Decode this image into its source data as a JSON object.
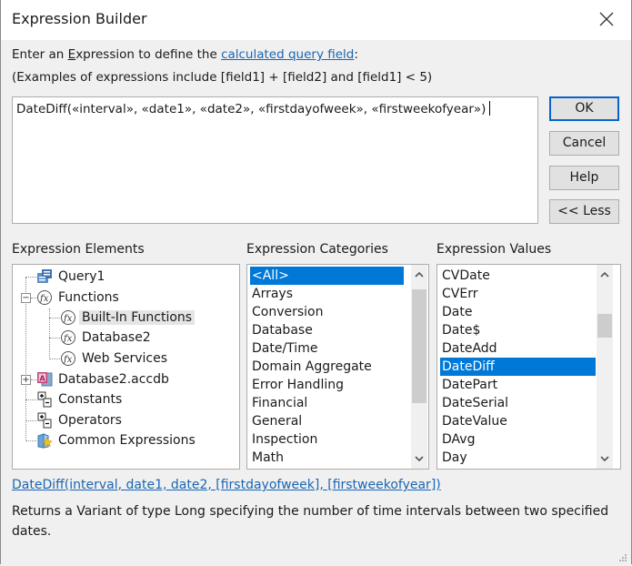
{
  "window": {
    "title": "Expression Builder",
    "close_icon": "close-icon"
  },
  "intro": {
    "line1_prefix": "Enter an ",
    "line1_accel": "E",
    "line1_mid": "xpression to define the ",
    "line1_link": "calculated query field",
    "line1_suffix": ":",
    "line2": "(Examples of expressions include [field1] + [field2] and [field1] < 5)"
  },
  "expression": {
    "value": "DateDiff(«interval», «date1», «date2», «firstdayofweek», «firstweekofyear»)"
  },
  "buttons": {
    "ok": "OK",
    "cancel": "Cancel",
    "help": "Help",
    "less": "<< Less"
  },
  "elements": {
    "header": "Expression Elements",
    "items": [
      {
        "label": "Query1",
        "icon": "query-icon",
        "level": 0,
        "expander": ""
      },
      {
        "label": "Functions",
        "icon": "function-icon",
        "level": 0,
        "expander": "collapse"
      },
      {
        "label": "Built-In Functions",
        "icon": "function-icon",
        "level": 1,
        "expander": "",
        "selected": true
      },
      {
        "label": "Database2",
        "icon": "function-icon",
        "level": 1,
        "expander": ""
      },
      {
        "label": "Web Services",
        "icon": "function-icon",
        "level": 1,
        "expander": ""
      },
      {
        "label": "Database2.accdb",
        "icon": "access-database-icon",
        "level": 0,
        "expander": "expand"
      },
      {
        "label": "Constants",
        "icon": "constants-icon",
        "level": 0,
        "expander": ""
      },
      {
        "label": "Operators",
        "icon": "operators-icon",
        "level": 0,
        "expander": ""
      },
      {
        "label": "Common Expressions",
        "icon": "common-expressions-icon",
        "level": 0,
        "expander": ""
      }
    ]
  },
  "categories": {
    "header": "Expression Categories",
    "selected": "<All>",
    "items": [
      "<All>",
      "Arrays",
      "Conversion",
      "Database",
      "Date/Time",
      "Domain Aggregate",
      "Error Handling",
      "Financial",
      "General",
      "Inspection",
      "Math"
    ]
  },
  "values": {
    "header": "Expression Values",
    "selected": "DateDiff",
    "items": [
      "CVDate",
      "CVErr",
      "Date",
      "Date$",
      "DateAdd",
      "DateDiff",
      "DatePart",
      "DateSerial",
      "DateValue",
      "DAvg",
      "Day"
    ]
  },
  "help": {
    "syntax": "DateDiff(interval, date1, date2, [firstdayofweek], [firstweekofyear])",
    "description": "Returns a Variant of type Long specifying the number of time intervals between two specified dates."
  },
  "colors": {
    "selection": "#0078d7",
    "link": "#1a66b3",
    "default_button_border": "#0a64c8",
    "background": "#f0f0f0"
  }
}
